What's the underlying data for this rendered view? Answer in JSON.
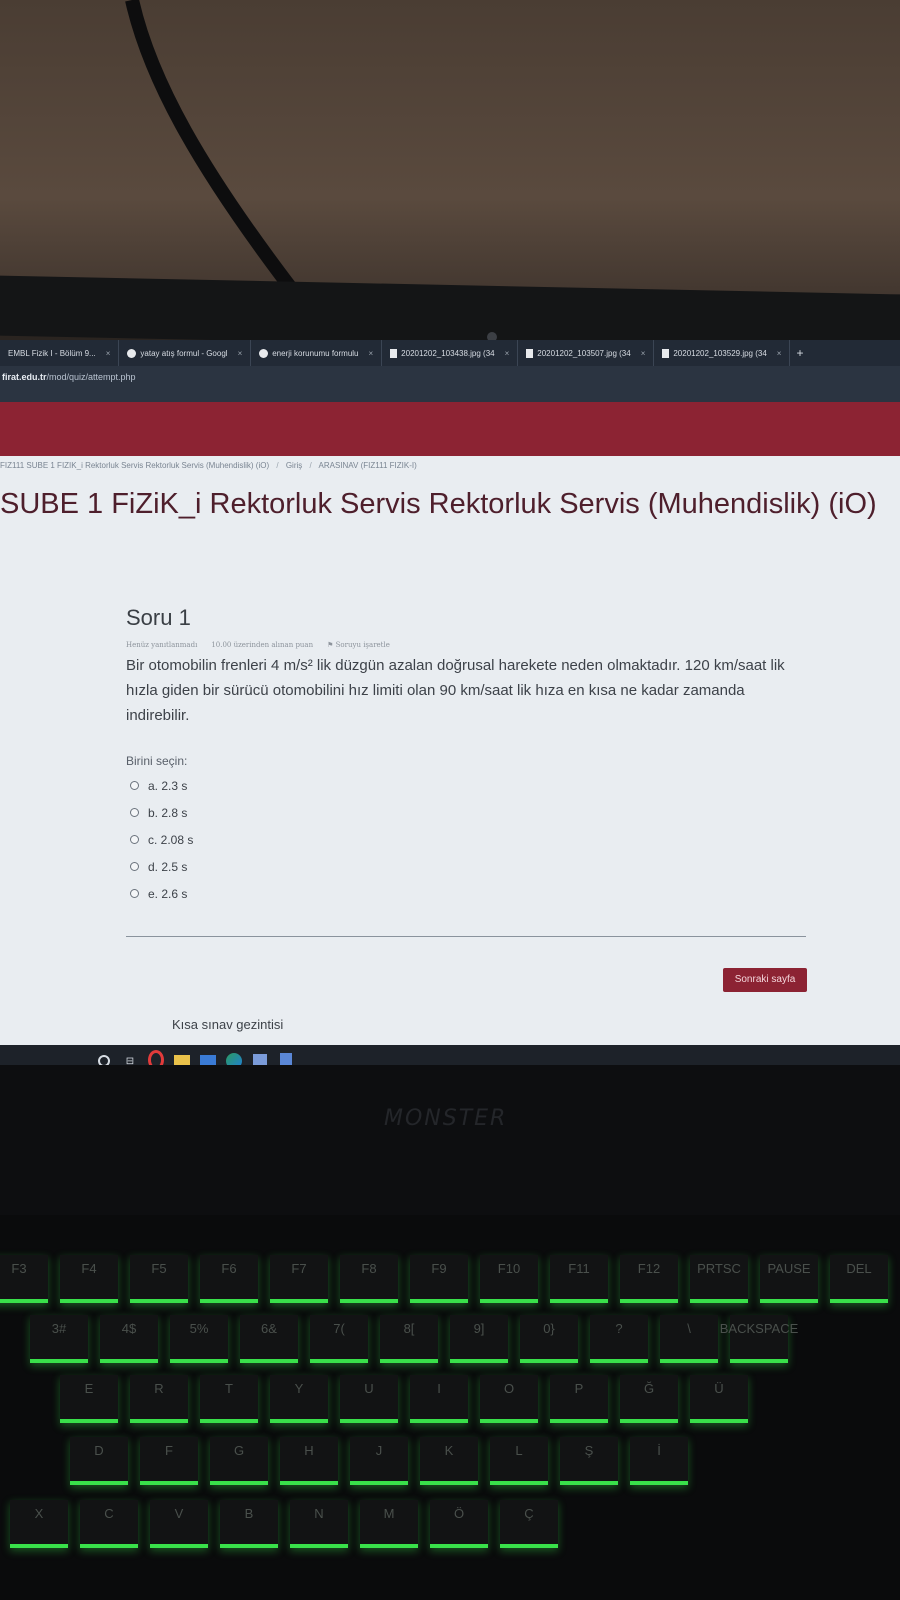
{
  "browser": {
    "tabs": [
      {
        "label": "EMBL Fizik I - Bölüm 9..."
      },
      {
        "label": "yatay atış formul - Googl"
      },
      {
        "label": "enerji korunumu formulu"
      },
      {
        "label": "20201202_103438.jpg (34"
      },
      {
        "label": "20201202_103507.jpg (34"
      },
      {
        "label": "20201202_103529.jpg (34"
      }
    ],
    "new_tab_label": "+",
    "url_domain": "firat.edu.tr",
    "url_path": "/mod/quiz/attempt.php"
  },
  "breadcrumb": {
    "items": [
      "FIZ111 SUBE 1 FIZIK_i Rektorluk Servis Rektorluk Servis (Muhendislik) (iO)",
      "Giriş",
      "ARASINAV (FIZ111 FIZIK-I)"
    ],
    "separator": "/"
  },
  "course_title": "SUBE 1 FiZiK_i Rektorluk Servis Rektorluk Servis (Muhendislik) (iO)",
  "question": {
    "title": "Soru 1",
    "status": "Henüz yanıtlanmadı",
    "points": "10.00 üzerinden alınan puan",
    "flag_label": "Soruyu işaretle",
    "text": "Bir otomobilin frenleri 4 m/s² lik düzgün azalan doğrusal harekete neden olmaktadır. 120 km/saat lik hızla giden bir sürücü otomobilini hız limiti olan 90 km/saat lik hıza en kısa ne kadar zamanda indirebilir.",
    "choose_label": "Birini seçin:",
    "options": [
      {
        "label": "a. 2.3 s"
      },
      {
        "label": "b. 2.8 s"
      },
      {
        "label": "c. 2.08 s"
      },
      {
        "label": "d. 2.5 s"
      },
      {
        "label": "e. 2.6 s"
      }
    ]
  },
  "next_button": "Sonraki sayfa",
  "quiz_nav_label": "Kısa sınav gezintisi",
  "laptop_brand": "MONSTER",
  "colors": {
    "brand_red": "#8c2333",
    "title_text": "#4e1f2c",
    "keyboard_glow": "#39e04a"
  },
  "keyboard": {
    "rows": [
      [
        "F3",
        "F4",
        "F5",
        "F6",
        "F7",
        "F8",
        "F9",
        "F10",
        "F11",
        "F12",
        "PRTSC",
        "PAUSE",
        "DEL"
      ],
      [
        "3#",
        "4$",
        "5%",
        "6&",
        "7(",
        "8[",
        "9]",
        "0}",
        "?",
        "\\",
        "BACKSPACE"
      ],
      [
        "E",
        "R",
        "T",
        "Y",
        "U",
        "I",
        "O",
        "P",
        "Ğ",
        "Ü"
      ],
      [
        "D",
        "F",
        "G",
        "H",
        "J",
        "K",
        "L",
        "Ş",
        "İ"
      ],
      [
        "X",
        "C",
        "V",
        "B",
        "N",
        "M",
        "Ö",
        "Ç"
      ]
    ]
  }
}
